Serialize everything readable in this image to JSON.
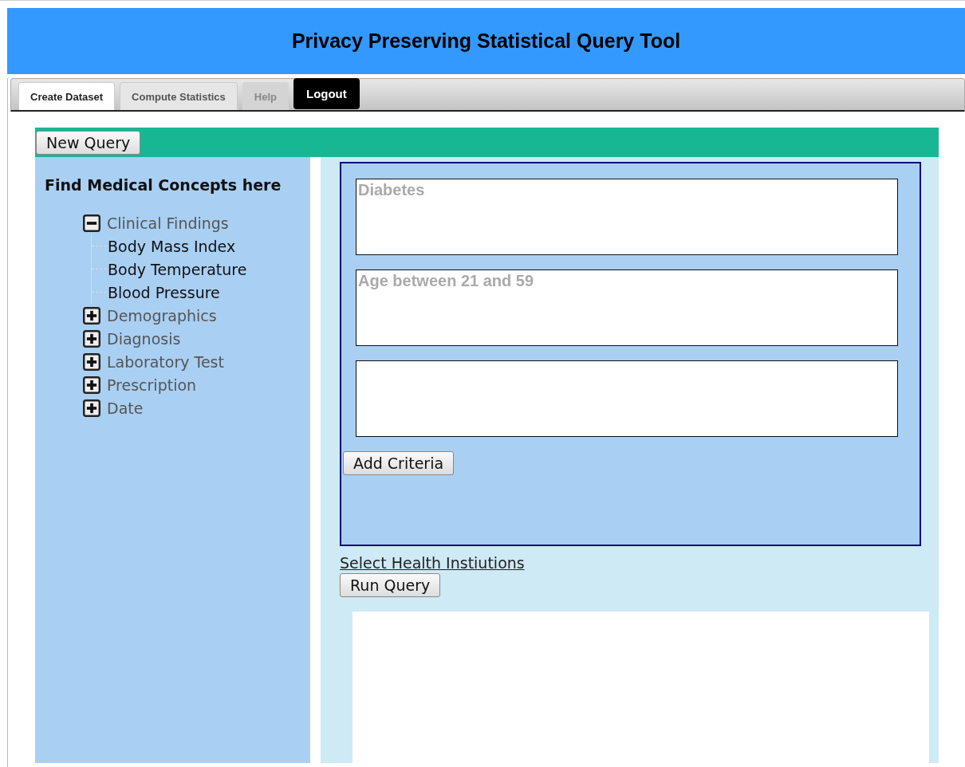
{
  "header": {
    "title": "Privacy Preserving Statistical Query Tool"
  },
  "tabs": [
    {
      "label": "Create Dataset",
      "kind": "tab",
      "selected": true,
      "disabled": false
    },
    {
      "label": "Compute Statistics",
      "kind": "tab",
      "selected": false,
      "disabled": false
    },
    {
      "label": "Help",
      "kind": "tab",
      "selected": false,
      "disabled": true
    },
    {
      "label": "Logout",
      "kind": "button",
      "disabled": false
    }
  ],
  "toolbar": {
    "new_query_button": "New Query"
  },
  "sidebar": {
    "title": "Find Medical Concepts here",
    "tree": [
      {
        "label": "Clinical Findings",
        "expanded": true,
        "children": [
          {
            "label": "Body Mass Index"
          },
          {
            "label": "Body Temperature"
          },
          {
            "label": "Blood Pressure"
          }
        ]
      },
      {
        "label": "Demographics",
        "expanded": false
      },
      {
        "label": "Diagnosis",
        "expanded": false
      },
      {
        "label": "Laboratory Test",
        "expanded": false
      },
      {
        "label": "Prescription",
        "expanded": false
      },
      {
        "label": "Date",
        "expanded": false
      }
    ]
  },
  "criteria": {
    "fields": [
      {
        "kind": "criterion",
        "placeholder": "Diabetes"
      },
      {
        "kind": "criterion",
        "placeholder": "Age between 21 and 59"
      },
      {
        "kind": "criterion"
      }
    ],
    "add_button": "Add Criteria"
  },
  "select_link": "Select Health Instiutions",
  "run_button": "Run Query"
}
